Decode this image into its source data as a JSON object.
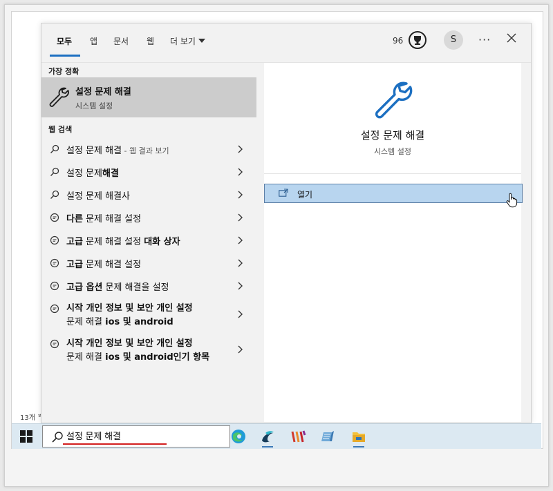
{
  "taskbar": {
    "search_text": "설정 문제 해결",
    "apps": [
      "edge-icon",
      "photo-editor-icon",
      "code-editor-icon",
      "notepad-icon",
      "file-explorer-icon"
    ]
  },
  "background": {
    "item_count_text": "13개 ᄒ"
  },
  "top_bar": {
    "tabs": [
      "모두",
      "앱",
      "문서",
      "웹",
      "더 보기"
    ],
    "reward_points": "96",
    "avatar_initial": "S",
    "ellipsis": "···"
  },
  "left": {
    "best_match_heading": "가장 정확",
    "best_match": {
      "title": "설정 문제 해결",
      "subtitle": "시스템 설정"
    },
    "web_heading": "웹 검색",
    "results": [
      {
        "icon": "search-icon",
        "text_a": "설정 문제 해결",
        "text_b": "",
        "suffix": " - 웹 결과 보기"
      },
      {
        "icon": "search-icon",
        "text_a": "설정 문제",
        "text_b": "해결",
        "suffix": ""
      },
      {
        "icon": "search-icon",
        "text_a": "설정 문제 해결사",
        "text_b": "",
        "suffix": ""
      },
      {
        "icon": "chat-icon",
        "text_a": "다른",
        "text_b": " 문제 해결 설정",
        "suffix": ""
      },
      {
        "icon": "chat-icon",
        "text_a": "고급",
        "text_b": " 문제 해결 설정 ",
        "text_c": "대화 상자"
      },
      {
        "icon": "chat-icon",
        "text_a": "고급",
        "text_b": " 문제 해결 설정",
        "suffix": ""
      },
      {
        "icon": "chat-icon",
        "text_a": "고급 옵션",
        "text_b": " 문제 해결을 설정",
        "suffix": ""
      },
      {
        "icon": "chat-icon",
        "line1": "시작 개인 정보 및 보안 개인 설정",
        "line2a": "문제 해결 ",
        "line2b": "ios 및 android"
      },
      {
        "icon": "chat-icon",
        "line1": "시작 개인 정보 및 보안 개인 설정",
        "line2a": "문제 해결 ",
        "line2b": "ios 및 android인기 항목"
      }
    ]
  },
  "right": {
    "title": "설정 문제 해결",
    "subtitle": "시스템 설정",
    "open_label": "열기"
  },
  "colors": {
    "accent": "#1c6fc1",
    "selected_bg": "#b8d5ef",
    "highlight_gray": "#cccccc"
  }
}
